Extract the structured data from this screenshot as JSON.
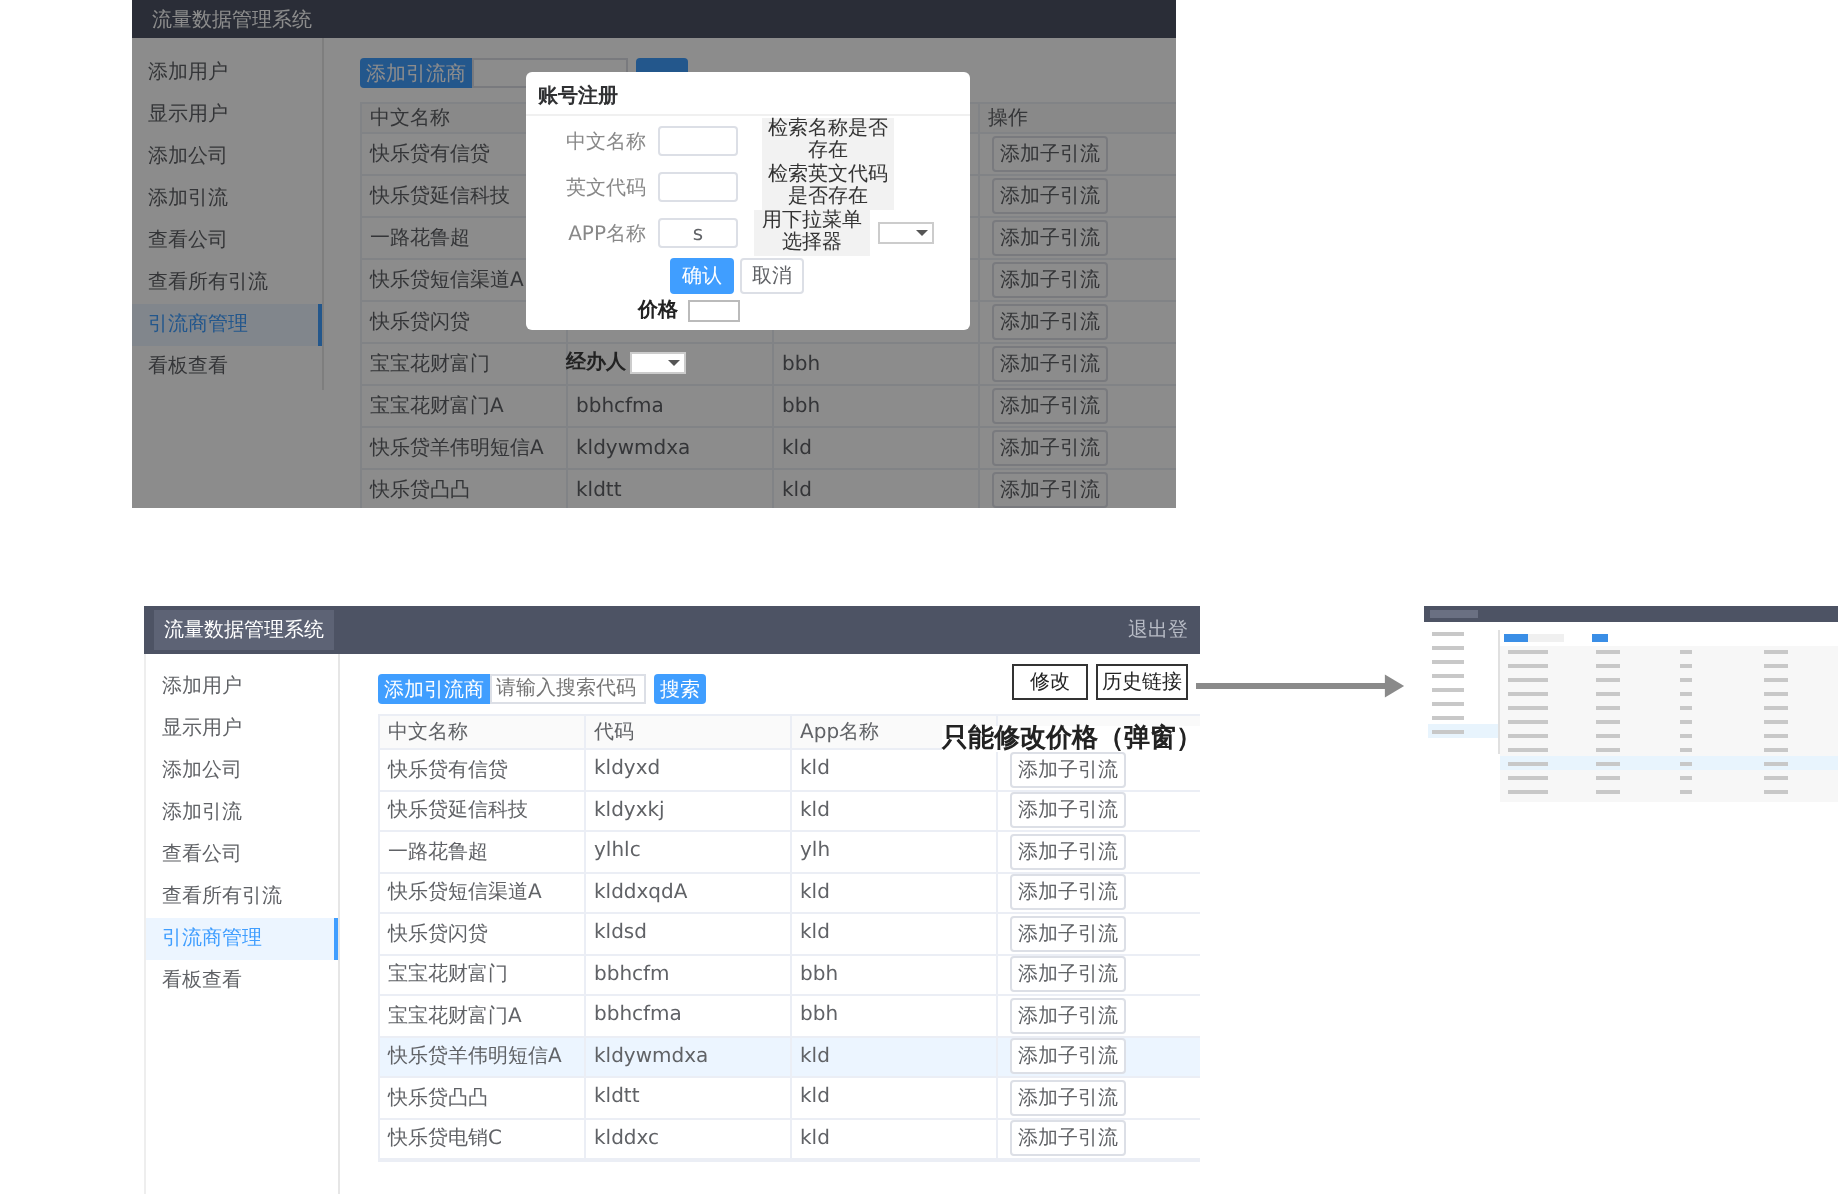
{
  "top_screen": {
    "header_title": "流量数据管理系统",
    "sidebar": [
      {
        "label": "添加用户",
        "selected": false
      },
      {
        "label": "显示用户",
        "selected": false
      },
      {
        "label": "添加公司",
        "selected": false
      },
      {
        "label": "添加引流",
        "selected": false
      },
      {
        "label": "查看公司",
        "selected": false
      },
      {
        "label": "查看所有引流",
        "selected": false
      },
      {
        "label": "引流商管理",
        "selected": true
      },
      {
        "label": "看板查看",
        "selected": false
      }
    ],
    "toolbar": {
      "add_button": "添加引流商"
    },
    "table": {
      "columns": {
        "name": "中文名称",
        "action": "操作"
      },
      "rows": [
        {
          "name": "快乐贷有信贷",
          "action": "添加子引流"
        },
        {
          "name": "快乐贷延信科技",
          "action": "添加子引流"
        },
        {
          "name": "一路花鲁超",
          "action": "添加子引流"
        },
        {
          "name": "快乐贷短信渠道A",
          "action": "添加子引流"
        },
        {
          "name": "快乐贷闪贷",
          "action": "添加子引流"
        },
        {
          "name": "宝宝花财富门",
          "app": "bbh",
          "action": "添加子引流"
        },
        {
          "name": "宝宝花财富门A",
          "code": "bbhcfma",
          "app": "bbh",
          "action": "添加子引流"
        },
        {
          "name": "快乐贷羊伟明短信A",
          "code": "kldywmdxa",
          "app": "kld",
          "action": "添加子引流"
        },
        {
          "name": "快乐贷凸凸",
          "code": "kldtt",
          "app": "kld",
          "action": "添加子引流"
        }
      ]
    },
    "modal": {
      "title": "账号注册",
      "fields": [
        {
          "kind": "check",
          "label": "中文名称",
          "button": "检索名称是否存在"
        },
        {
          "kind": "check",
          "label": "英文代码",
          "button": "检索英文代码是否存在"
        },
        {
          "kind": "select",
          "label": "APP名称",
          "value": "s",
          "note": "用下拉菜单选择器"
        }
      ],
      "buttons": [
        {
          "label": "确认",
          "primary": true
        },
        {
          "label": "取消",
          "primary": false
        }
      ],
      "price_label": "价格"
    },
    "handler_label": "经办人"
  },
  "bottom_screen": {
    "header_title": "流量数据管理系统",
    "logout": "退出登",
    "sidebar": [
      {
        "label": "添加用户",
        "selected": false
      },
      {
        "label": "显示用户",
        "selected": false
      },
      {
        "label": "添加公司",
        "selected": false
      },
      {
        "label": "添加引流",
        "selected": false
      },
      {
        "label": "查看公司",
        "selected": false
      },
      {
        "label": "查看所有引流",
        "selected": false
      },
      {
        "label": "引流商管理",
        "selected": true
      },
      {
        "label": "看板查看",
        "selected": false
      }
    ],
    "toolbar": {
      "add_button": "添加引流商",
      "search_placeholder": "请输入搜索代码",
      "search_button": "搜索"
    },
    "table": {
      "columns": {
        "name": "中文名称",
        "code": "代码",
        "app": "App名称"
      },
      "rows": [
        {
          "name": "快乐贷有信贷",
          "code": "kldyxd",
          "app": "kld",
          "action": "添加子引流",
          "highlighted": false
        },
        {
          "name": "快乐贷延信科技",
          "code": "kldyxkj",
          "app": "kld",
          "action": "添加子引流",
          "highlighted": false
        },
        {
          "name": "一路花鲁超",
          "code": "ylhlc",
          "app": "ylh",
          "action": "添加子引流",
          "highlighted": false
        },
        {
          "name": "快乐贷短信渠道A",
          "code": "klddxqdA",
          "app": "kld",
          "action": "添加子引流",
          "highlighted": false
        },
        {
          "name": "快乐贷闪贷",
          "code": "kldsd",
          "app": "kld",
          "action": "添加子引流",
          "highlighted": false
        },
        {
          "name": "宝宝花财富门",
          "code": "bbhcfm",
          "app": "bbh",
          "action": "添加子引流",
          "highlighted": false
        },
        {
          "name": "宝宝花财富门A",
          "code": "bbhcfma",
          "app": "bbh",
          "action": "添加子引流",
          "highlighted": false
        },
        {
          "name": "快乐贷羊伟明短信A",
          "code": "kldywmdxa",
          "app": "kld",
          "action": "添加子引流",
          "highlighted": true
        },
        {
          "name": "快乐贷凸凸",
          "code": "kldtt",
          "app": "kld",
          "action": "添加子引流",
          "highlighted": false
        },
        {
          "name": "快乐贷电销C",
          "code": "klddxc",
          "app": "kld",
          "action": "添加子引流",
          "highlighted": false
        }
      ]
    }
  },
  "annotations": {
    "buttons": [
      "修改",
      "历史链接"
    ],
    "note": "只能修改价格（弹窗）"
  }
}
